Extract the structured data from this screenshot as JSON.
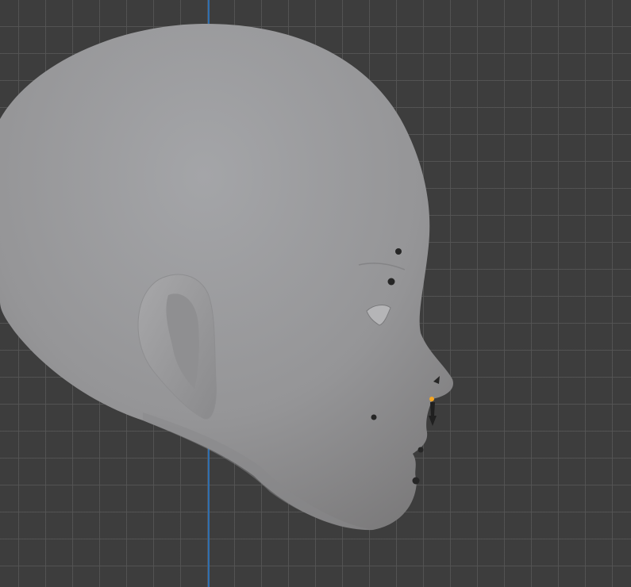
{
  "viewport": {
    "colors": {
      "background": "#3d3d3d",
      "grid": "#555555",
      "axis_y": "#2f6fb0",
      "mesh": "#9a9a9a",
      "selected_bone": "#f5a623"
    }
  }
}
